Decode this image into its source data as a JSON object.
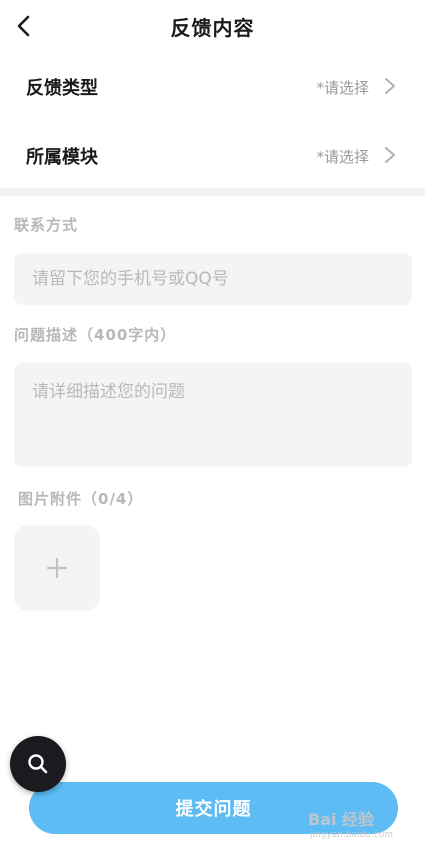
{
  "header": {
    "title": "反馈内容",
    "back_icon": "chevron-left-icon"
  },
  "rows": [
    {
      "label": "反馈类型",
      "value": "*请选择"
    },
    {
      "label": "所属模块",
      "value": "*请选择"
    }
  ],
  "contact": {
    "label": "联系方式",
    "placeholder": "请留下您的手机号或QQ号"
  },
  "description": {
    "label": "问题描述（400字内）",
    "placeholder": "请详细描述您的问题"
  },
  "attachments": {
    "label": "图片附件（0/4）"
  },
  "submit": {
    "label": "提交问题"
  },
  "watermark": {
    "text": "Bai 经验",
    "sub": "jingyan.baidu.com"
  },
  "colors": {
    "accent": "#5cbcf3",
    "fab": "#1a1a1f",
    "field_bg": "#f4f4f4"
  }
}
